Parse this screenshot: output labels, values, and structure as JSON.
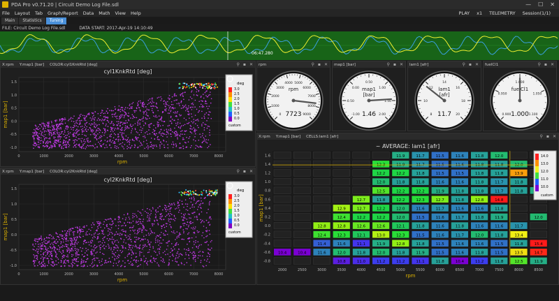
{
  "app": {
    "title": "PDA Pro v0.71.20  |  Circuit Demo Log File.sdl",
    "minimize": "—",
    "maximize": "☐",
    "close": "✕"
  },
  "menu": {
    "items": [
      "File",
      "Layout",
      "Tab",
      "Graph/Report",
      "Data",
      "Math",
      "View",
      "Help"
    ],
    "right": [
      "PLAY",
      "x1",
      "TELEMETRY",
      "Session(1/1)"
    ]
  },
  "tabs": [
    "Main",
    "Statistics",
    "Tuning"
  ],
  "active_tab": 2,
  "filebar": {
    "file": "FILE: Circuit Demo Log File.sdl",
    "date": "DATA START: 2017-Apr-19  14:10:49"
  },
  "trace": {
    "cursor_label": "06:47.280"
  },
  "scatter1": {
    "header": [
      "X:rpm",
      "Y:map1 [bar]",
      "COLOR:cyl1KnkRtd [deg]"
    ],
    "title": "cyl1KnkRtd [deg]"
  },
  "scatter2": {
    "header": [
      "X:rpm",
      "Y:map1 [bar]",
      "COLOR:cyl2KnkRtd [deg]"
    ],
    "title": "cyl2KnkRtd [deg]"
  },
  "scatter_axes": {
    "xlabel": "rpm",
    "ylabel": "map1 [bar]",
    "xticks": [
      "0",
      "1000",
      "2000",
      "3000",
      "4000",
      "5000",
      "6000",
      "7000",
      "8000"
    ],
    "yticks": [
      "1.5",
      "1.0",
      "0.5",
      "0.0",
      "-0.5",
      "-1.0"
    ],
    "legend_title": "deg",
    "legend_ticks": [
      "3.0",
      "2.5",
      "2.0",
      "1.5",
      "1.0",
      "0.5",
      "0.0"
    ],
    "legend_custom": "custom"
  },
  "gauges": [
    {
      "header": "rpm",
      "label": "rpm",
      "value": "7723",
      "ticks": [
        "0",
        "1000",
        "2000",
        "3000",
        "4000",
        "5000",
        "6000",
        "7000",
        "8000",
        "9000"
      ]
    },
    {
      "header": "map1 [bar]",
      "label": "map1\n[bar]",
      "value": "1.46",
      "ticks": [
        "-1.00",
        "-0.50",
        "0.00",
        "0.50",
        "1.00",
        "1.50",
        "2.00"
      ]
    },
    {
      "header": "lam1 [afr]",
      "label": "lam1\n[afr]",
      "value": "11.7",
      "ticks": [
        "8",
        "10",
        "12",
        "14",
        "16",
        "18",
        "20"
      ]
    },
    {
      "header": "fuelCl1",
      "label": "fuelCl1",
      "value": "1.000",
      "ticks": [
        "0.900",
        "0.950",
        "1.000",
        "1.050",
        "1.100"
      ]
    }
  ],
  "heatmap": {
    "header": [
      "X:rpm",
      "Y:map1 [bar]",
      "CELLS:lam1 [afr]"
    ],
    "title": "~ AVERAGE: lam1 [afr]",
    "xlabel": "rpm",
    "ylabel": "map1 [bar]",
    "xticks": [
      "2000",
      "2500",
      "3000",
      "3500",
      "4000",
      "4500",
      "5000",
      "5500",
      "6000",
      "6500",
      "7000",
      "7500",
      "8000",
      "8500"
    ],
    "yticks": [
      "1.6",
      "1.4",
      "1.2",
      "1.0",
      "0.8",
      "0.6",
      "0.4",
      "0.2",
      "0.0",
      "-0.2",
      "-0.4",
      "-0.6",
      "-0.8"
    ],
    "legend_ticks": [
      "14.0",
      "13.0",
      "12.0",
      "11.0",
      "10.0"
    ],
    "legend_custom": "custom",
    "colors": {
      "min": "#7b00d4",
      "max": "#ff1a1a"
    },
    "rows": [
      [
        null,
        null,
        null,
        null,
        null,
        null,
        "11.9",
        "11.7",
        "11.5",
        "11.6",
        "11.8",
        "12.0",
        null,
        null
      ],
      [
        null,
        null,
        null,
        null,
        null,
        "12.3",
        "11.9",
        "11.7",
        "11.5",
        "11.6",
        "11.8",
        "11.8",
        "12.0",
        null
      ],
      [
        null,
        null,
        null,
        null,
        null,
        "12.2",
        "12.2",
        "11.8",
        "11.5",
        "11.5",
        "11.8",
        "11.8",
        "13.9",
        null
      ],
      [
        null,
        null,
        null,
        null,
        null,
        "12.0",
        "11.8",
        "11.8",
        "11.6",
        "11.6",
        "11.8",
        "11.7",
        "11.8",
        null
      ],
      [
        null,
        null,
        null,
        null,
        null,
        "12.5",
        "12.2",
        "12.2",
        "11.9",
        "11.8",
        "11.8",
        "11.7",
        "11.8",
        "11.9"
      ],
      [
        null,
        null,
        null,
        null,
        "12.7",
        "11.8",
        "12.2",
        "12.3",
        "12.7",
        "11.8",
        "12.8",
        "14.8",
        null,
        null
      ],
      [
        null,
        null,
        null,
        "12.9",
        "12.7",
        "12.2",
        "12.0",
        "11.6",
        "11.7",
        "11.6",
        "11.6",
        "11.8",
        null,
        null
      ],
      [
        null,
        null,
        null,
        "12.4",
        "12.2",
        "12.2",
        "12.0",
        "11.5",
        "11.6",
        "11.7",
        "11.8",
        "11.9",
        null,
        "12.0"
      ],
      [
        null,
        null,
        "12.8",
        "12.8",
        "12.6",
        "12.6",
        "12.1",
        "11.8",
        "11.6",
        "11.8",
        "11.6",
        "11.6",
        "11.7",
        null
      ],
      [
        null,
        null,
        "12.4",
        "12.3",
        "12.1",
        "13.0",
        "12.3",
        "11.5",
        "11.6",
        "11.7",
        "12.0",
        "11.8",
        "13.4",
        null
      ],
      [
        null,
        null,
        "11.4",
        "11.6",
        "11.1",
        "11.9",
        "12.8",
        "11.8",
        "11.5",
        "11.6",
        "11.6",
        "11.5",
        "11.8",
        "15.4"
      ],
      [
        "10.4",
        "10.4",
        "11.6",
        "12.0",
        "11.8",
        "12.0",
        "11.8",
        "11.9",
        "11.5",
        "11.6",
        "11.8",
        "11.5",
        "13.5",
        "14.7"
      ],
      [
        null,
        null,
        null,
        "10.8",
        "11.0",
        "11.2",
        "11.2",
        "11.1",
        "11.8",
        "10.4",
        "11.2",
        "11.8",
        "12.5",
        "11.9"
      ]
    ]
  }
}
